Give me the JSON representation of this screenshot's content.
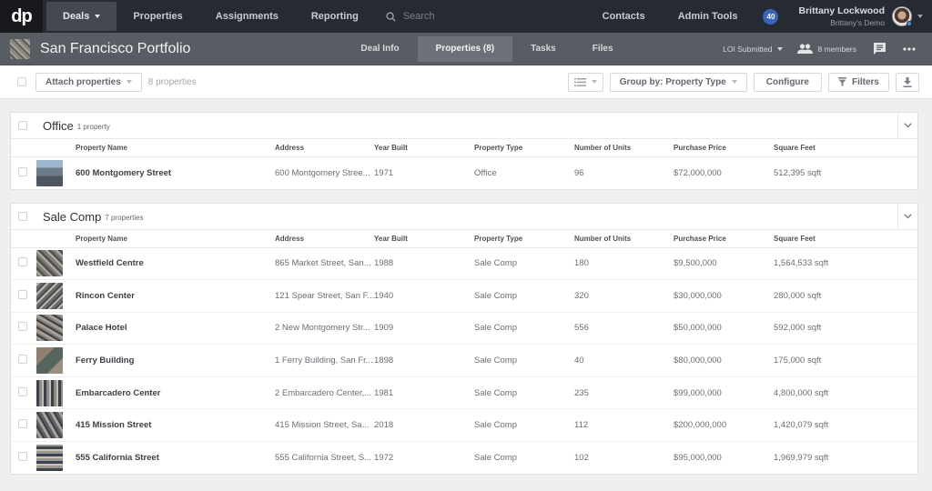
{
  "topnav": {
    "logo": "dp",
    "items": [
      {
        "label": "Deals",
        "active": true,
        "dropdown": true
      },
      {
        "label": "Properties"
      },
      {
        "label": "Assignments"
      },
      {
        "label": "Reporting"
      }
    ],
    "search_placeholder": "Search",
    "right_items": [
      {
        "label": "Contacts"
      },
      {
        "label": "Admin Tools"
      }
    ],
    "notification_count": "40",
    "user": {
      "name": "Brittany Lockwood",
      "org": "Brittany's Demo"
    }
  },
  "deal": {
    "title": "San Francisco Portfolio",
    "tabs": [
      {
        "label": "Deal Info"
      },
      {
        "label": "Properties (8)",
        "active": true
      },
      {
        "label": "Tasks"
      },
      {
        "label": "Files"
      }
    ],
    "status": "LOI Submitted",
    "members": "8 members"
  },
  "toolbar": {
    "attach_label": "Attach properties",
    "count_text": "8 properties",
    "group_by_label": "Group by: Property Type",
    "configure_label": "Configure",
    "filters_label": "Filters"
  },
  "columns": [
    "Property Name",
    "Address",
    "Year Built",
    "Property Type",
    "Number of Units",
    "Purchase Price",
    "Square Feet"
  ],
  "groups": [
    {
      "title": "Office",
      "count": "1 property",
      "rows": [
        {
          "name": "600 Montgomery Street",
          "address": "600 Montgomery Stree...",
          "year": "1971",
          "type": "Office",
          "units": "96",
          "price": "$72,000,000",
          "sqft": "512,395 sqft"
        }
      ]
    },
    {
      "title": "Sale Comp",
      "count": "7 properties",
      "rows": [
        {
          "name": "Westfield Centre",
          "address": "865 Market Street, San...",
          "year": "1988",
          "type": "Sale Comp",
          "units": "180",
          "price": "$9,500,000",
          "sqft": "1,564,533 sqft"
        },
        {
          "name": "Rincon Center",
          "address": "121 Spear Street, San F...",
          "year": "1940",
          "type": "Sale Comp",
          "units": "320",
          "price": "$30,000,000",
          "sqft": "280,000 sqft"
        },
        {
          "name": "Palace Hotel",
          "address": "2 New Montgomery Str...",
          "year": "1909",
          "type": "Sale Comp",
          "units": "556",
          "price": "$50,000,000",
          "sqft": "592,000 sqft"
        },
        {
          "name": "Ferry Building",
          "address": "1 Ferry Building, San Fr...",
          "year": "1898",
          "type": "Sale Comp",
          "units": "40",
          "price": "$80,000,000",
          "sqft": "175,000 sqft"
        },
        {
          "name": "Embarcadero Center",
          "address": "2 Embarcadero Center,...",
          "year": "1981",
          "type": "Sale Comp",
          "units": "235",
          "price": "$99,000,000",
          "sqft": "4,800,000 sqft"
        },
        {
          "name": "415 Mission Street",
          "address": "415 Mission Street, Sa...",
          "year": "2018",
          "type": "Sale Comp",
          "units": "112",
          "price": "$200,000,000",
          "sqft": "1,420,079 sqft"
        },
        {
          "name": "555 California Street",
          "address": "555 California Street, S...",
          "year": "1972",
          "type": "Sale Comp",
          "units": "102",
          "price": "$95,000,000",
          "sqft": "1,969,979 sqft"
        }
      ]
    }
  ]
}
